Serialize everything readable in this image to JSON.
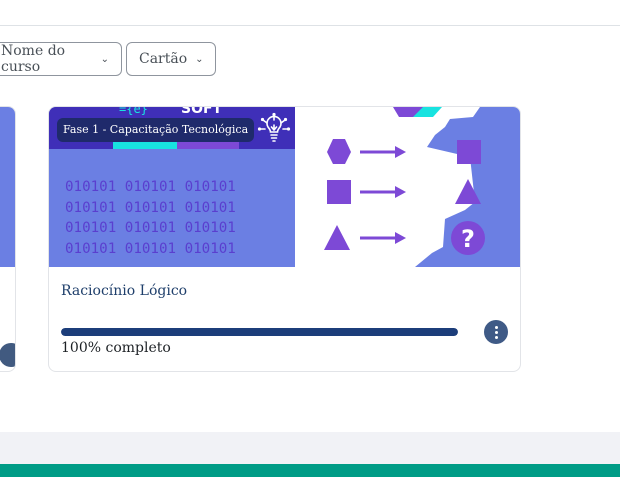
{
  "filters": {
    "sort_label": "Nome do curso",
    "view_label": "Cartão"
  },
  "course_card": {
    "image": {
      "stage_label": "Fase 1 - Capacitação Tecnológica",
      "soft_text": "SOFT",
      "code_text": "={e}",
      "binary_lines": [
        "010101 010101 010101",
        "010101 010101 010101",
        "010101 010101 010101",
        "010101 010101 010101"
      ],
      "question_mark": "?"
    },
    "name": "Raciocínio Lógico",
    "progress_fraction": 1.0,
    "progress_text": "100% completo",
    "menu_icon": "kebab-vertical-icon"
  },
  "colors": {
    "image_bg": "#6b7fe3",
    "accent_purple": "#7d49d6",
    "progress": "#1c3d7a",
    "footer_teal": "#009c86"
  }
}
